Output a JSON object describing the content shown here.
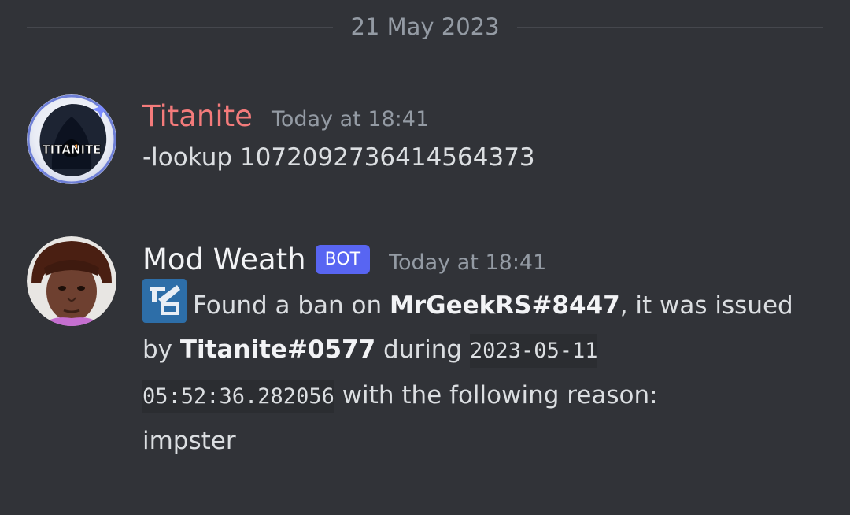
{
  "divider": {
    "date": "21 May 2023"
  },
  "messages": [
    {
      "author": "Titanite",
      "author_color": "#f47b7b",
      "timestamp": "Today at 18:41",
      "text": "-lookup 1072092736414564373",
      "avatar_text": "TITANITE"
    },
    {
      "author": "Mod Weath",
      "author_color": "#f2f3f5",
      "badge": "BOT",
      "timestamp": "Today at 18:41",
      "parts": {
        "t1": "Found a ban on ",
        "user": "MrGeekRS#8447",
        "t2": ", it was issued by ",
        "issuer": "Titanite#0577",
        "t3": " during ",
        "code1": "2023-05-11",
        "code2": "05:52:36.282056",
        "t4": " with the following reason:",
        "reason": "impster"
      },
      "emoji_icon": "ban-hammer-emoji-icon"
    }
  ],
  "colors": {
    "background": "#313338",
    "bot_badge": "#5865f2",
    "muted": "#949ba4"
  }
}
